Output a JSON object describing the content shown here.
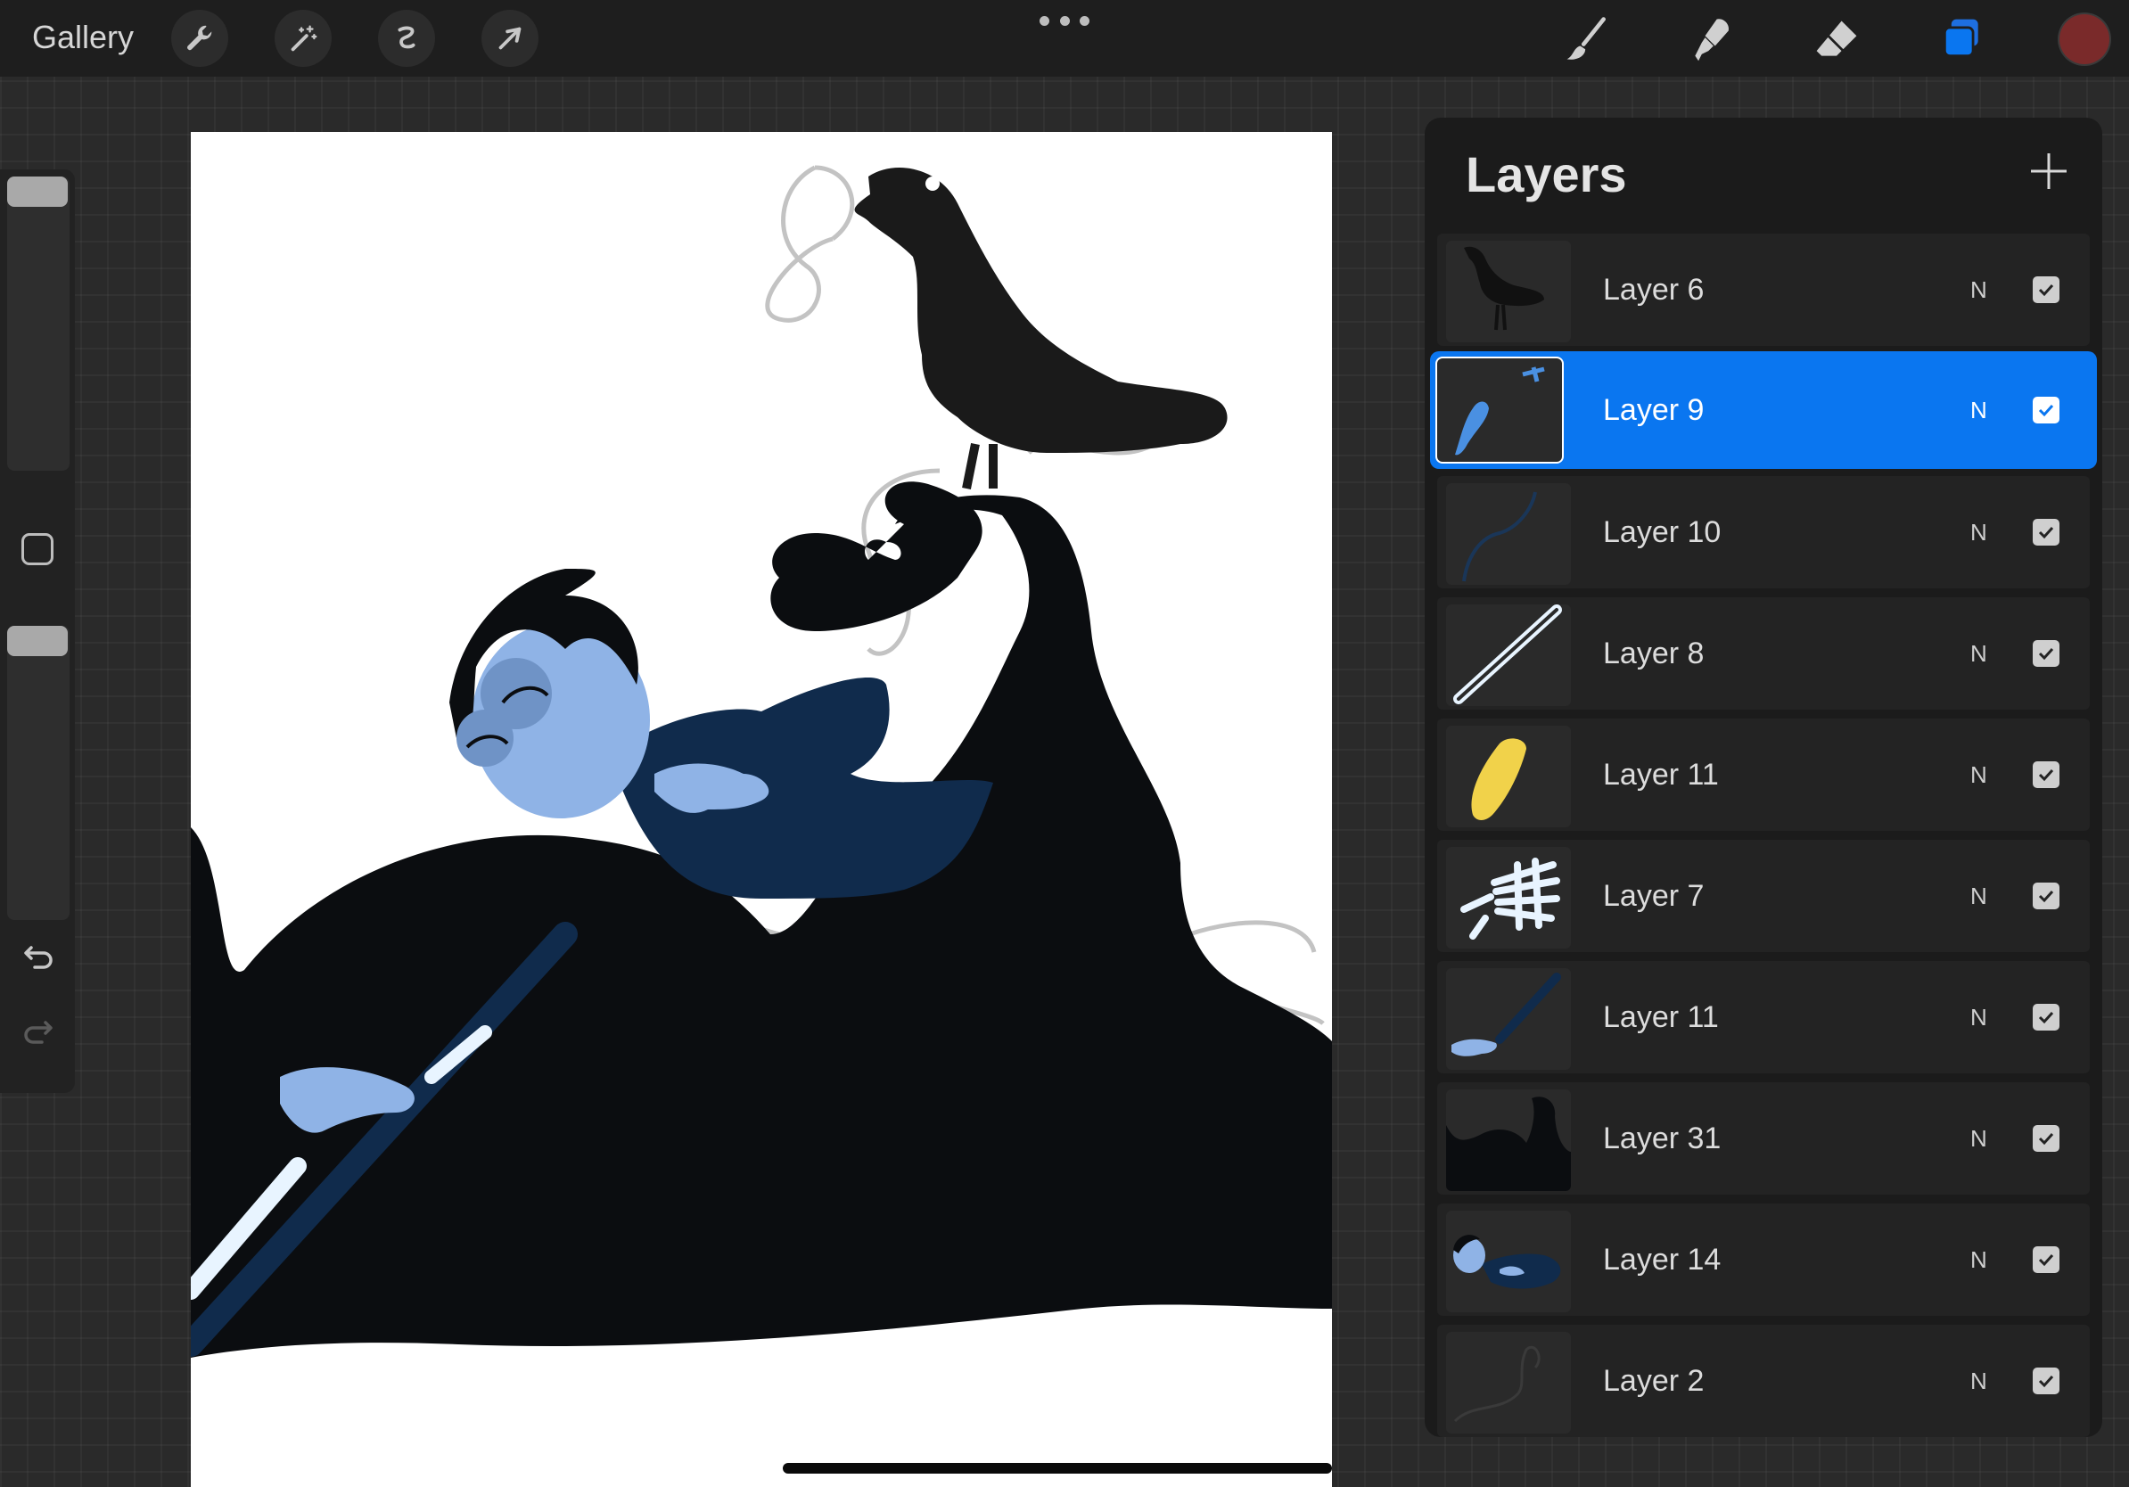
{
  "topbar": {
    "gallery_label": "Gallery",
    "left_tools": [
      "wrench-icon",
      "magic-wand-icon",
      "selection-icon",
      "transform-arrow-icon"
    ],
    "right_tools": [
      "brush-icon",
      "smudge-icon",
      "eraser-icon",
      "layers-icon"
    ],
    "active_color": "#7a2a2a",
    "accent": "#0a76f0"
  },
  "layers": {
    "title": "Layers",
    "add_icon": "plus-icon",
    "items": [
      {
        "name": "Layer 6",
        "blend": "N",
        "visible": true,
        "selected": false
      },
      {
        "name": "Layer 9",
        "blend": "N",
        "visible": true,
        "selected": true
      },
      {
        "name": "Layer 10",
        "blend": "N",
        "visible": true,
        "selected": false
      },
      {
        "name": "Layer 8",
        "blend": "N",
        "visible": true,
        "selected": false
      },
      {
        "name": "Layer 11",
        "blend": "N",
        "visible": true,
        "selected": false
      },
      {
        "name": "Layer 7",
        "blend": "N",
        "visible": true,
        "selected": false
      },
      {
        "name": "Layer 11",
        "blend": "N",
        "visible": true,
        "selected": false
      },
      {
        "name": "Layer 31",
        "blend": "N",
        "visible": true,
        "selected": false
      },
      {
        "name": "Layer 14",
        "blend": "N",
        "visible": true,
        "selected": false
      },
      {
        "name": "Layer 2",
        "blend": "N",
        "visible": true,
        "selected": false
      }
    ]
  }
}
